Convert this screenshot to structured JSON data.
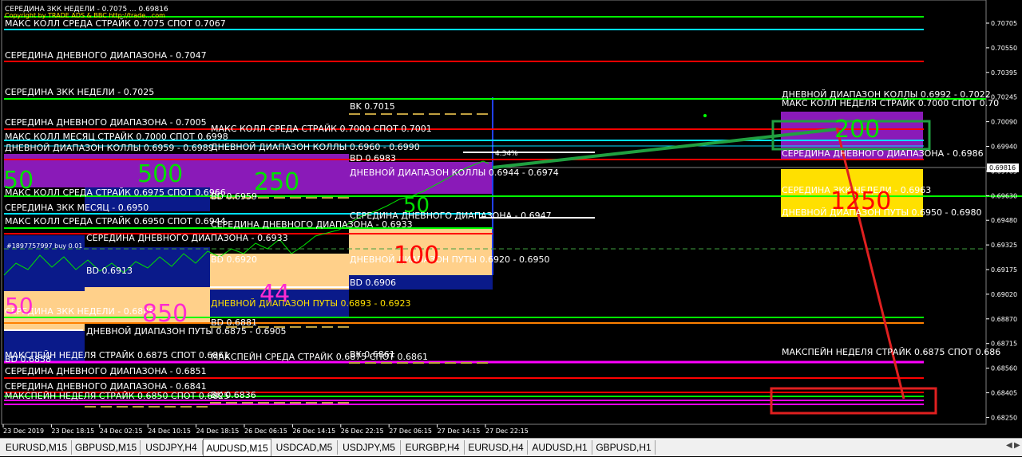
{
  "header": {
    "lines": [
      "СЕРЕДИНА ЗКК НЕДЕЛИ - 0.7075 ... 0.69816",
      "Copyright by TRADE ADS & BBC http://trade...com"
    ]
  },
  "colors": {
    "bg": "#000000",
    "green": "#00ff00",
    "cyan": "#00e0ff",
    "red": "#ff0000",
    "magenta": "#ff00ff",
    "purple": "#8a1ab8",
    "navy": "#0a1a8a",
    "peach": "#ffd08a",
    "yellow": "#ffe000",
    "white": "#ffffff",
    "numGreen": "#00e000",
    "numRed": "#ff0000",
    "numPink": "#ff2ad0"
  },
  "levels": [
    {
      "label": "МАКС КОЛЛ СРЕДА СТРАЙК 0.7075 СПОТ 0.7067",
      "color": "cyan"
    },
    {
      "label": "СЕРЕДИНА ДНЕВНОГО ДИАПАЗОНА - 0.7047",
      "color": "red"
    },
    {
      "label": "СЕРЕДИНА ЗКК НЕДЕЛИ - 0.7025",
      "color": "green"
    },
    {
      "label": "СЕРЕДИНА ДНЕВНОГО ДИАПАЗОНА - 0.7005",
      "color": "red"
    },
    {
      "label": "МАКС КОЛЛ МЕСЯЦ СТРАЙК 0.7000 СПОТ 0.6998",
      "color": "cyan"
    },
    {
      "label": "ДНЕВНОЙ ДИАПАЗОН КОЛЛЫ 0.6959 - 0.6989",
      "color": "white"
    },
    {
      "label": "МАКС КОЛЛ СРЕДА СТРАЙК 0.6975 СПОТ 0.6966",
      "color": "cyan"
    },
    {
      "label": "СЕРЕДИНА ЗКК МЕСЯЦ - 0.6950",
      "color": "green"
    },
    {
      "label": "МАКС КОЛЛ СРЕДА СТРАЙК 0.6950 СПОТ 0.6944",
      "color": "cyan"
    },
    {
      "label": "СЕРЕДИНА ДНЕВНОГО ДИАПАЗОНА - 0.6933",
      "color": "red"
    },
    {
      "label": "СЕРЕДИНА ЗКК НЕДЕЛИ - 0.6888",
      "color": "green"
    },
    {
      "label": "ДНЕВНОЙ ДИАПАЗОН ПУТЫ 0.6875 - 0.6905",
      "color": "yellow"
    },
    {
      "label": "МАКСПЕЙН НЕДЕЛЯ СТРАЙК 0.6875 СПОТ 0.6861",
      "color": "magenta"
    },
    {
      "label": "СЕРЕДИНА ДНЕВНОГО ДИАПАЗОНА - 0.6851",
      "color": "red"
    },
    {
      "label": "СЕРЕДИНА ДНЕВНОГО ДИАПАЗОНА - 0.6841",
      "color": "red"
    },
    {
      "label": "МАКСПЕЙН НЕДЕЛЯ СТРАЙК 0.6850 СПОТ 0.6825",
      "color": "magenta"
    }
  ],
  "mid_labels": {
    "call_wed": "МАКС КОЛЛ СРЕДА СТРАЙК 0.7000 СПОТ 0.7001",
    "day_calls_1": "ДНЕВНОЙ ДИАПАЗОН КОЛЛЫ 0.6960 - 0.6990",
    "day_mid_1": "СЕРЕДИНА ДНЕВНОГО ДИАПАЗОНА - 0.6933",
    "day_puts_1": "ДНЕВНОЙ ДИАПАЗОН ПУТЫ 0.6893 - 0.6923",
    "maxpain_wed": "МАКСПЕЙН СРЕДА СТРАЙК 0.6875 СПОТ 0.6861",
    "bk_7015": "BK 0.7015",
    "bd_6983": "BD 0.6983",
    "day_calls_2": "ДНЕВНОЙ ДИАПАЗОН КОЛЛЫ 0.6944 - 0.6974",
    "day_mid_2": "СЕРЕДИНА ДНЕВНОГО ДИАПАЗОНА - 0.6947",
    "day_puts_2": "ДНЕВНОЙ ДИАПАЗОН ПУТЫ 0.6920 - 0.6950",
    "bd_6906": "BD 0.6906",
    "bd_6959": "BD 0.6959",
    "bd_6920": "BD 0.6920",
    "bd_6881": "BD 0.6881",
    "bk_6836": "BK 0.6836",
    "bd_6913": "BD 0.6913",
    "bd_6858": "BD 0.6858",
    "bk_6861": "BK 0.6861",
    "order": "#1897757997 buy 0.01",
    "pct": "4.34%"
  },
  "right_labels": {
    "day_calls": "ДНЕВНОЙ ДИАПАЗОН КОЛЛЫ 0.6992 - 0.7022",
    "call_week": "МАКС КОЛЛ НЕДЕЛЯ СТРАЙК 0.7000 СПОТ 0.70",
    "day_mid": "СЕРЕДИНА ДНЕВНОГО ДИАПАЗОНА - 0.6986",
    "zkk_mid": "СЕРЕДИНА ЗКК НЕДЕЛИ - 0.6963",
    "day_puts": "ДНЕВНОЙ ДИАПАЗОН ПУТЫ 0.6950 - 0.6980",
    "maxpain_week": "МАКСПЕЙН НЕДЕЛЯ СТРАЙК 0.6875 СПОТ 0.686"
  },
  "numbers": {
    "n500": "500",
    "n250": "250",
    "n50a": "50",
    "n50b": "50",
    "n50c": "50",
    "n100": "100",
    "n44": "44",
    "n850": "850",
    "n200": "200",
    "n1250": "1250"
  },
  "price_axis": {
    "ticks": [
      "0.70705",
      "0.70550",
      "0.70395",
      "0.70245",
      "0.70090",
      "0.69940",
      "0.69785",
      "0.69630",
      "0.69480",
      "0.69325",
      "0.69175",
      "0.69020",
      "0.68870",
      "0.68715",
      "0.68560",
      "0.68405",
      "0.68250"
    ],
    "current": "0.69816"
  },
  "time_axis": {
    "ticks": [
      "23 Dec 2019",
      "23 Dec 18:15",
      "24 Dec 02:15",
      "24 Dec 10:15",
      "24 Dec 18:15",
      "26 Dec 06:15",
      "26 Dec 14:15",
      "26 Dec 22:15",
      "27 Dec 06:15",
      "27 Dec 14:15",
      "27 Dec 22:15"
    ]
  },
  "tabs": [
    {
      "label": "EURUSD,M15"
    },
    {
      "label": "GBPUSD,M15"
    },
    {
      "label": "USDJPY,H4"
    },
    {
      "label": "AUDUSD,M15",
      "active": true
    },
    {
      "label": "USDCAD,M5"
    },
    {
      "label": "USDJPY,M5"
    },
    {
      "label": "EURGBP,H4"
    },
    {
      "label": "EURUSD,H4"
    },
    {
      "label": "AUDUSD,H1"
    },
    {
      "label": "GBPUSD,H1"
    }
  ]
}
